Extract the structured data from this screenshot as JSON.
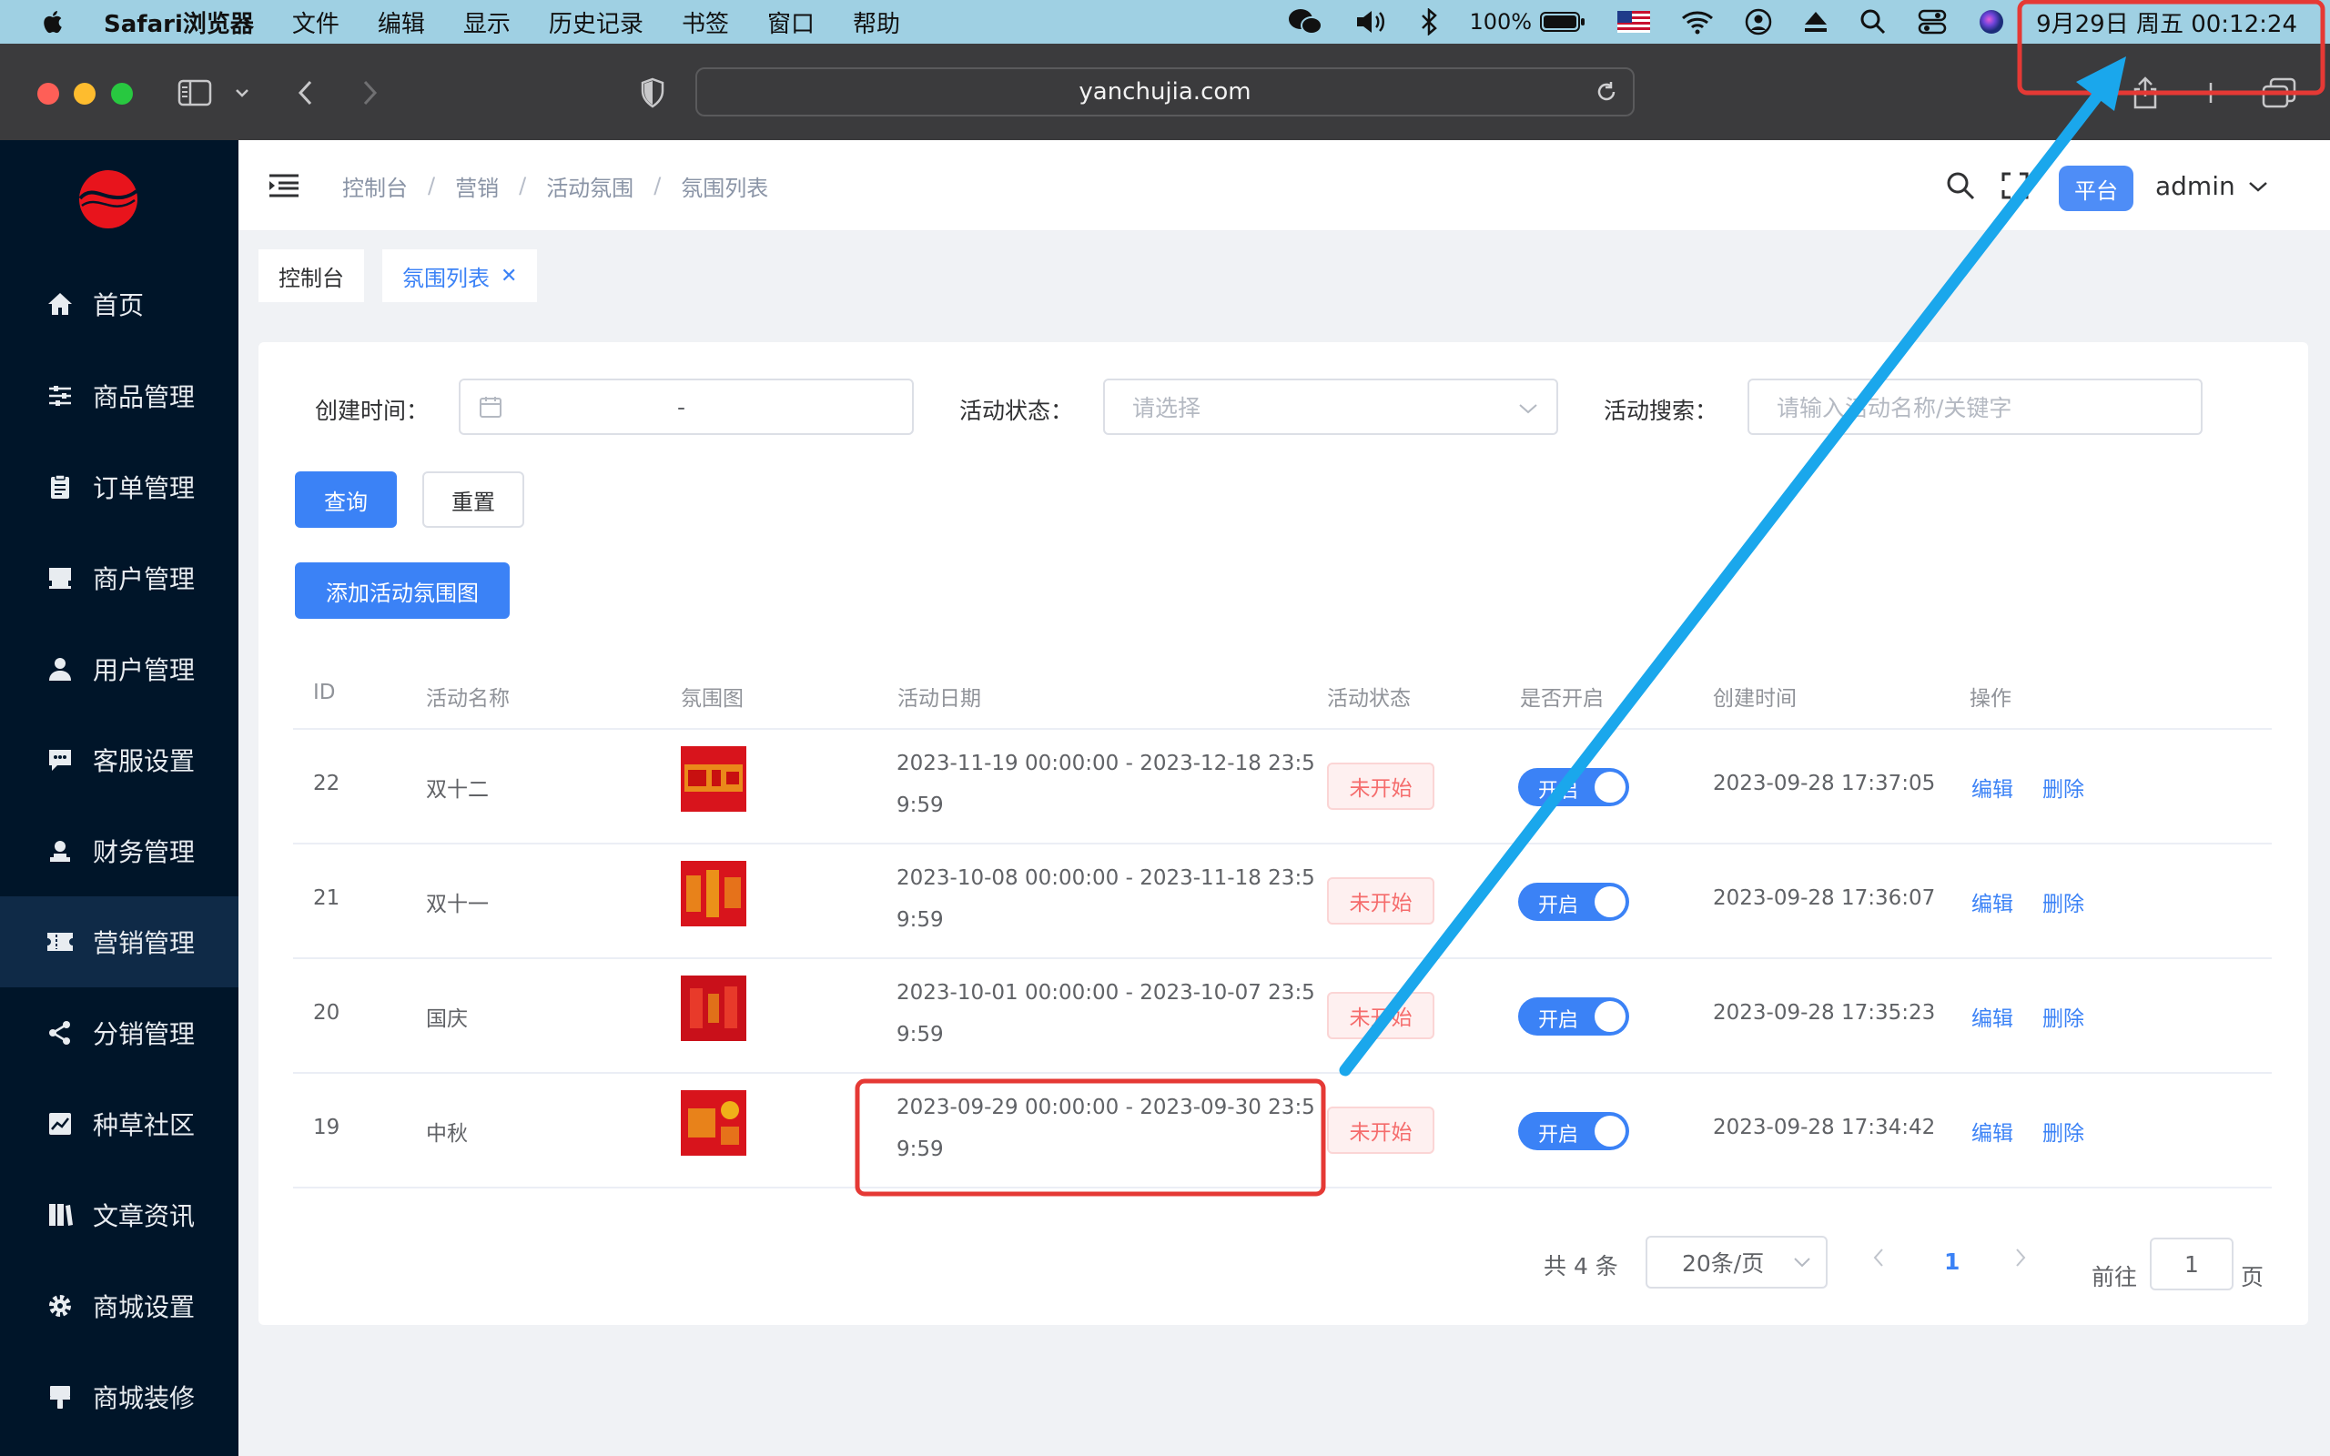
{
  "menubar": {
    "app_name": "Safari浏览器",
    "menus": [
      "文件",
      "编辑",
      "显示",
      "历史记录",
      "书签",
      "窗口",
      "帮助"
    ],
    "battery": "100%",
    "clock": "9月29日 周五  00:12:24"
  },
  "browser": {
    "url": "yanchujia.com"
  },
  "sidebar": {
    "items": [
      {
        "label": "首页",
        "icon": "home-icon"
      },
      {
        "label": "商品管理",
        "icon": "sliders-icon"
      },
      {
        "label": "订单管理",
        "icon": "clipboard-icon"
      },
      {
        "label": "商户管理",
        "icon": "store-icon"
      },
      {
        "label": "用户管理",
        "icon": "user-icon"
      },
      {
        "label": "客服设置",
        "icon": "chat-icon"
      },
      {
        "label": "财务管理",
        "icon": "finance-icon"
      },
      {
        "label": "营销管理",
        "icon": "ticket-icon",
        "active": true
      },
      {
        "label": "分销管理",
        "icon": "share-icon"
      },
      {
        "label": "种草社区",
        "icon": "chart-icon"
      },
      {
        "label": "文章资讯",
        "icon": "book-icon"
      },
      {
        "label": "商城设置",
        "icon": "gear-icon"
      },
      {
        "label": "商城装修",
        "icon": "brush-icon"
      }
    ]
  },
  "header": {
    "breadcrumb": [
      "控制台",
      "营销",
      "活动氛围",
      "氛围列表"
    ],
    "platform_label": "平台",
    "user": "admin"
  },
  "tags": [
    {
      "label": "控制台"
    },
    {
      "label": "氛围列表",
      "active": true
    }
  ],
  "filters": {
    "created_label": "创建时间：",
    "range_separator": "-",
    "status_label": "活动状态：",
    "status_placeholder": "请选择",
    "search_label": "活动搜索：",
    "search_placeholder": "请输入活动名称/关键字",
    "query_button": "查询",
    "reset_button": "重置",
    "add_button": "添加活动氛围图"
  },
  "table": {
    "columns": [
      "ID",
      "活动名称",
      "氛围图",
      "活动日期",
      "活动状态",
      "是否开启",
      "创建时间",
      "操作"
    ],
    "rows": [
      {
        "id": "22",
        "name": "双十二",
        "date": "2023-11-19 00:00:00 - 2023-12-18 23:59:59",
        "status": "未开始",
        "switch": "开启",
        "created": "2023-09-28 17:37:05",
        "edit": "编辑",
        "delete": "删除"
      },
      {
        "id": "21",
        "name": "双十一",
        "date": "2023-10-08 00:00:00 - 2023-11-18 23:59:59",
        "status": "未开始",
        "switch": "开启",
        "created": "2023-09-28 17:36:07",
        "edit": "编辑",
        "delete": "删除"
      },
      {
        "id": "20",
        "name": "国庆",
        "date": "2023-10-01 00:00:00 - 2023-10-07 23:59:59",
        "status": "未开始",
        "switch": "开启",
        "created": "2023-09-28 17:35:23",
        "edit": "编辑",
        "delete": "删除"
      },
      {
        "id": "19",
        "name": "中秋",
        "date": "2023-09-29 00:00:00 - 2023-09-30 23:59:59",
        "status": "未开始",
        "switch": "开启",
        "created": "2023-09-28 17:34:42",
        "edit": "编辑",
        "delete": "删除"
      }
    ]
  },
  "pagination": {
    "total": "共 4 条",
    "page_size": "20条/页",
    "current": "1",
    "goto_prefix": "前往",
    "goto_value": "1",
    "goto_suffix": "页"
  },
  "colors": {
    "sidebar_bg": "#001529",
    "primary": "#3b82f6",
    "danger": "#f56c6c",
    "annotation_red": "#e53935",
    "annotation_arrow": "#1aa7ec"
  }
}
